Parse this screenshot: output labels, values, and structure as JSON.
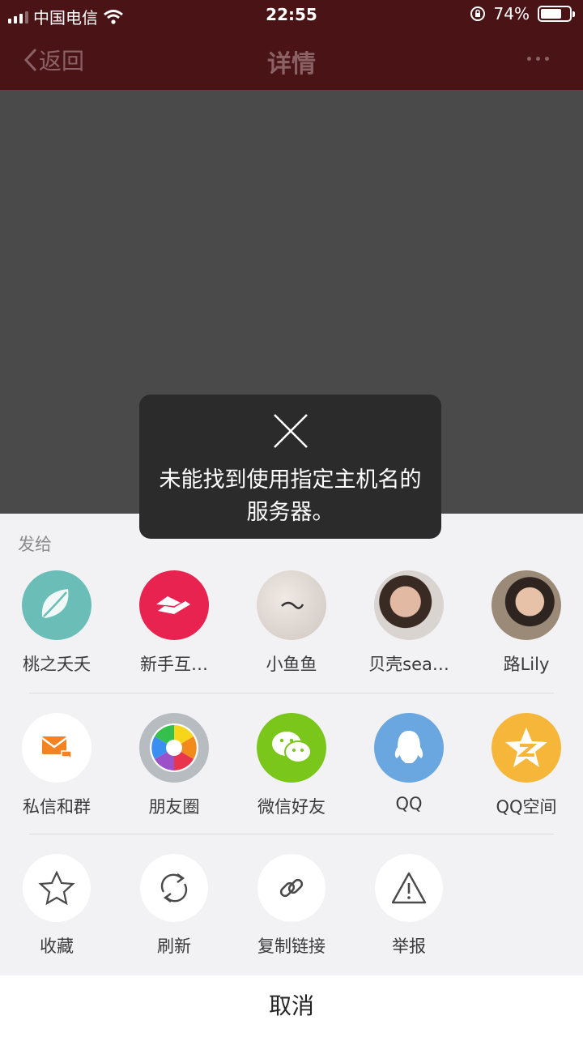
{
  "status_bar": {
    "carrier": "中国电信",
    "time": "22:55",
    "battery": "74%",
    "battery_level": 0.74
  },
  "nav": {
    "back_label": "返回",
    "title": "详情"
  },
  "sheet": {
    "section_label": "发给",
    "contacts": [
      {
        "name": "桃之夭夭",
        "avatar": "leaf-avatar",
        "color": "#6bbdb8"
      },
      {
        "name": "新手互…",
        "avatar": "handshake-avatar",
        "color": "#e8234f"
      },
      {
        "name": "小鱼鱼",
        "avatar": "photo-avatar",
        "color": "#d8d2cc"
      },
      {
        "name": "贝壳sea…",
        "avatar": "photo-avatar",
        "color": "#b89a86"
      },
      {
        "name": "路Lily",
        "avatar": "photo-avatar",
        "color": "#8a6f5a"
      }
    ],
    "share_targets": [
      {
        "name": "私信和群",
        "icon": "mail-icon",
        "color": "#ffffff"
      },
      {
        "name": "朋友圈",
        "icon": "moments-icon",
        "color": "#b7bcc1"
      },
      {
        "name": "微信好友",
        "icon": "wechat-icon",
        "color": "#7ac61b"
      },
      {
        "name": "QQ",
        "icon": "qq-icon",
        "color": "#6aa6e0"
      },
      {
        "name": "QQ空间",
        "icon": "qzone-icon",
        "color": "#f5b63a"
      }
    ],
    "actions": [
      {
        "name": "收藏",
        "icon": "star-icon"
      },
      {
        "name": "刷新",
        "icon": "refresh-icon"
      },
      {
        "name": "复制链接",
        "icon": "link-icon"
      },
      {
        "name": "举报",
        "icon": "warning-icon"
      }
    ],
    "cancel_label": "取消"
  },
  "toast": {
    "message": "未能找到使用指定主机名的服务器。"
  }
}
